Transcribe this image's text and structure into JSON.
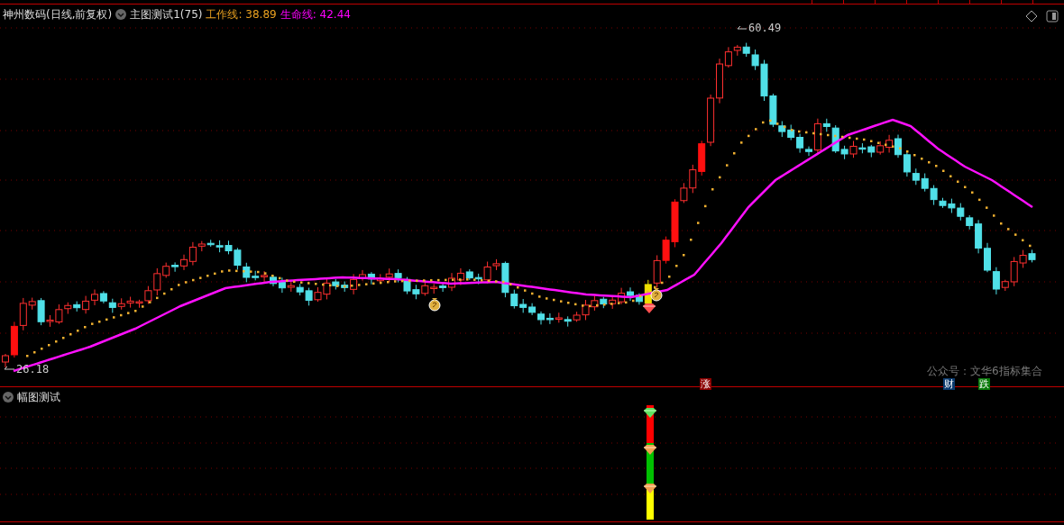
{
  "main_pane": {
    "title": "神州数码(日线,前复权)",
    "indicator": "主图测试1(75)",
    "legend": [
      {
        "label": "工作线: 38.89",
        "color": "#e8a020"
      },
      {
        "label": "生命线: 42.44",
        "color": "#ff00ff"
      }
    ],
    "high_label": "60.49",
    "low_label": "26.18",
    "signals": [
      {
        "text": "涨",
        "color": "#8b0000"
      },
      {
        "text": "财",
        "color": "#0a3a6e"
      },
      {
        "text": "跌",
        "color": "#0a7a0a"
      }
    ],
    "note": "公众号：文华6指标集合"
  },
  "sub_pane": {
    "title": "幅图测试"
  }
}
